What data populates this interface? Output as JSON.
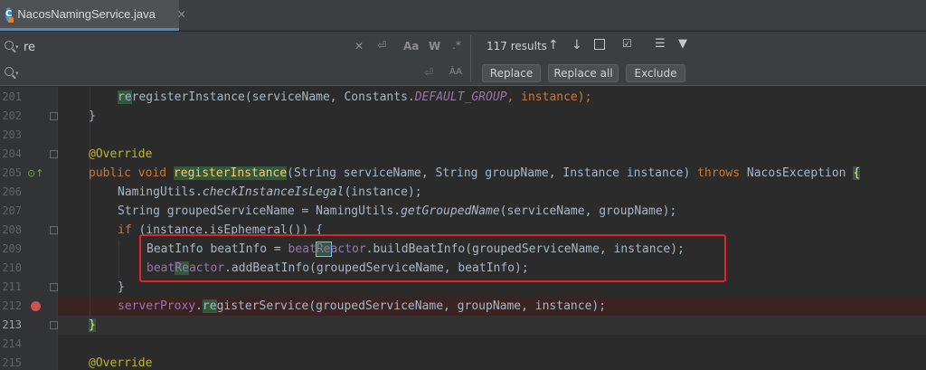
{
  "tab": {
    "label": "NacosNamingService.java",
    "close": "✕"
  },
  "find": {
    "value": "re",
    "placeholder_replace": "",
    "results": "117 results"
  },
  "replace_buttons": {
    "replace": "Replace",
    "replace_all": "Replace all",
    "exclude": "Exclude"
  },
  "icons": {
    "aa": "Aa",
    "w": "W",
    "regex": ".*",
    "close": "✕",
    "enter": "⏎",
    "up": "↑",
    "down": "↓"
  },
  "lines": [
    {
      "n": "201"
    },
    {
      "n": "202"
    },
    {
      "n": "203"
    },
    {
      "n": "204"
    },
    {
      "n": "205"
    },
    {
      "n": "206"
    },
    {
      "n": "207"
    },
    {
      "n": "208"
    },
    {
      "n": "209"
    },
    {
      "n": "210"
    },
    {
      "n": "211"
    },
    {
      "n": "212"
    },
    {
      "n": "213"
    },
    {
      "n": "214"
    },
    {
      "n": "215"
    }
  ],
  "code": {
    "l201": "registerInstance(serviceName, Constants.",
    "l201b": "DEFAULT_GROUP",
    "l201c": ", instance);",
    "l204": "@Override",
    "l205a": "public void ",
    "l205b": "registerInstance",
    "l205c": "(String serviceName, String groupName, Instance instance) ",
    "l205d": "throws ",
    "l205e": "NacosException ",
    "l206a": "NamingUtils.",
    "l206b": "checkInstanceIsLegal",
    "l206c": "(instance);",
    "l207a": "String groupedServiceName = NamingUtils.",
    "l207b": "getGroupedName",
    "l207c": "(serviceName, groupName);",
    "l208a": "if ",
    "l208b": "(instance.isEphemeral()) {",
    "l209a": "BeatInfo beatInfo = ",
    "l209b": "beat",
    "l209c": "Re",
    "l209d": "actor",
    "l209e": ".buildBeatInfo(groupedServiceName, instance);",
    "l210a": "beat",
    "l210b": "Re",
    "l210c": "actor",
    "l210d": ".addBeatInfo(groupedServiceName, beatInfo);",
    "l211": "}",
    "l212a": "serverProxy",
    "l212b": ".",
    "l212c": "re",
    "l212d": "gisterService(groupedServiceName, groupName, instance);",
    "l213": "}",
    "l215": "@Override"
  }
}
